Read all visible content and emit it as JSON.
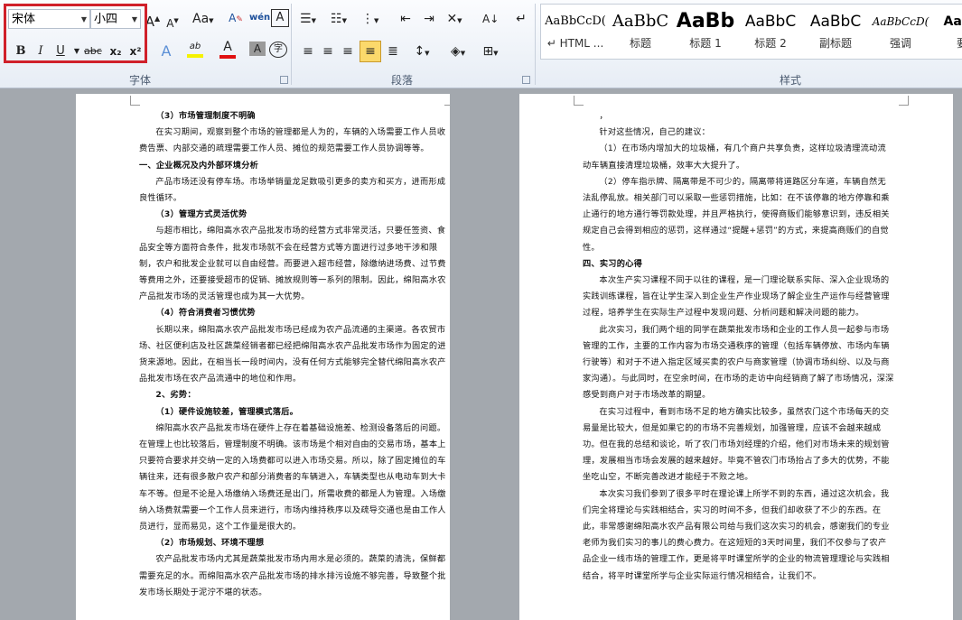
{
  "font_group": {
    "font_name": "宋体",
    "font_size": "小四",
    "grow": "A",
    "shrink": "A",
    "change_case": "Aa",
    "clear_format": "A",
    "phonetic": "wén",
    "border_char": "A",
    "bold": "B",
    "italic": "I",
    "underline": "U",
    "strike": "abc",
    "subscript": "x₂",
    "superscript": "x²",
    "text_effect": "A",
    "highlight": "ab",
    "font_color": "A",
    "shading": "A",
    "enclose": "字",
    "label": "字体"
  },
  "paragraph_group": {
    "label": "段落"
  },
  "styles_group": {
    "label": "样式",
    "items": [
      {
        "preview": "AaBbCcD(",
        "name": "↵ HTML ..."
      },
      {
        "preview": "AaBbC",
        "name": "标题"
      },
      {
        "preview": "AaBb",
        "name": "标题 1"
      },
      {
        "preview": "AaBbC",
        "name": "标题 2"
      },
      {
        "preview": "AaBbC",
        "name": "副标题"
      },
      {
        "preview": "AaBbCcD(",
        "name": "强调"
      },
      {
        "preview": "AaBb",
        "name": "要"
      }
    ]
  },
  "page1": [
    {
      "t": "（3）市场管理制度不明确",
      "c": "h"
    },
    {
      "t": "在实习期间，观察到整个市场的管理都是人为的，车辆的入场需要工作人员收费告票、内部交通的疏理需要工作人员、摊位的规范需要工作人员协调等等。",
      "c": "n"
    },
    {
      "t": "一、企业概况及内外部环境分析",
      "c": "h0"
    },
    {
      "t": "产品市场还没有停车场。市场举销量龙足数吸引更多的卖方和买方，进而形成良性循环。",
      "c": "n"
    },
    {
      "t": "（3）管理方式灵活优势",
      "c": "h"
    },
    {
      "t": "与超市相比，绵阳高水农产品批发市场的经营方式非常灵活，只要任签资、食品安全等方面符合条件，批发市场就不会在经营方式等方面进行过多地干涉和限制，农户和批发企业就可以自由经营。而要进入超市经营，除缴纳进场费、过节费等费用之外，还要接受超市的促销、摊放规则等一系列的限制。因此，绵阳高水农产品批发市场的灵活管理也成为其一大优势。",
      "c": "n"
    },
    {
      "t": "（4）符合消费者习惯优势",
      "c": "h"
    },
    {
      "t": "长期以来，绵阳高水农产品批发市场已经成为农产品流通的主渠道。各农贸市场、社区便利店及社区蔬菜经销者都已经把绵阳高水农产品批发市场作为固定的进货来源地。因此，在相当长一段时间内，没有任何方式能够完全替代绵阳高水农产品批发市场在农产品流通中的地位和作用。",
      "c": "n"
    },
    {
      "t": "2、劣势：",
      "c": "h"
    },
    {
      "t": "（1）硬件设施较差，管理模式落后。",
      "c": "h"
    },
    {
      "t": "绵阳高水农产品批发市场在硬件上存在着基础设施差、检测设备落后的问题。在管理上也比较落后，管理制度不明确。该市场是个相对自由的交易市场，基本上只要符合要求并交纳一定的入场费都可以进入市场交易。所以，除了固定摊位的车辆往来，还有很多散户农产和部分消费者的车辆进入，车辆类型也从电动车到大卡车不等。但是不论是入场缴纳入场费还是出门，所需收费的都是人为管理。入场缴纳入场费就需要一个工作人员来进行，市场内维持秩序以及疏导交通也是由工作人员进行，显而易见，这个工作量是很大的。",
      "c": "n"
    },
    {
      "t": "（2）市场规划、环境不理想",
      "c": "h"
    },
    {
      "t": "农产品批发市场内尤其是蔬菜批发市场内用水是必须的。蔬菜的清洗，保鲜都需要充足的水。而绵阳高水农产品批发市场的排水排污设施不够完善，导致整个批发市场长期处于泥泞不堪的状态。",
      "c": "n"
    }
  ],
  "page2": [
    {
      "t": "，",
      "c": "n"
    },
    {
      "t": "针对这些情况，自己的建议：",
      "c": "n"
    },
    {
      "t": "（1）在市场内增加大的垃圾桶，有几个商户共享负责，这样垃圾清理流动流动车辆直接清理垃圾桶，效率大大提升了。",
      "c": "n"
    },
    {
      "t": "（2）停车指示牌、隔离带是不可少的，隔离带将道路区分车道，车辆自然无法乱停乱放。相关部门可以采取一些惩罚措施，比如：在不该停靠的地方停靠和乘止通行的地方通行等罚款处理，并且严格执行，使得商贩们能够意识到，违反相关规定自己会得到相应的惩罚，这样通过“提醒+惩罚”的方式，来提高商贩们的自觉性。",
      "c": "n"
    },
    {
      "t": "四、实习的心得",
      "c": "h0"
    },
    {
      "t": "本次生产实习课程不同于以往的课程，是一门理论联系实际、深入企业现场的实践训练课程，旨在让学生深入到企业生产作业现场了解企业生产运作与经营管理过程，培养学生在实际生产过程中发现问题、分析问题和解决问题的能力。",
      "c": "n"
    },
    {
      "t": "此次实习，我们两个组的同学在蔬菜批发市场和企业的工作人员一起参与市场管理的工作，主要的工作内容为市场交通秩序的管理（包括车辆停放、市场内车辆行驶等）和对于不进入指定区域买卖的农户与商家管理（协调市场纠纷、以及与商家沟通）。与此同时，在空余时间，在市场的走访中向经销商了解了市场情况，深深感受到商户对于市场改革的期望。",
      "c": "n"
    },
    {
      "t": "在实习过程中，看到市场不足的地方确实比较多，虽然农门这个市场每天的交易量是比较大，但是如果它的的市场不完善规划，加强管理，应该不会越来越成功。但在我的总结和谈论，听了农门市场刘经理的介绍，他们对市场未来的规划管理，发展相当市场会发展的越来越好。毕竟不管农门市场抬占了多大的优势，不能坐吃山空，不断完善改进才能经于不败之地。",
      "c": "n"
    },
    {
      "t": "本次实习我们参到了很多平时在理论课上所学不到的东西，通过这次机会，我们完全将理论与实践相结合，实习的时间不多，但我们却收获了不少的东西。在此，非常感谢绵阳高水农产品有限公司给与我们这次实习的机会，感谢我们的专业老师为我们实习的事儿的费心费力。在这短短的3天时间里，我们不仅参与了农产品企业一线市场的管理工作，更是将平时课堂所学的企业的物流管理理论与实践相结合，将平时课堂所学与企业实际运行情况相结合，让我们不。",
      "c": "n"
    }
  ]
}
